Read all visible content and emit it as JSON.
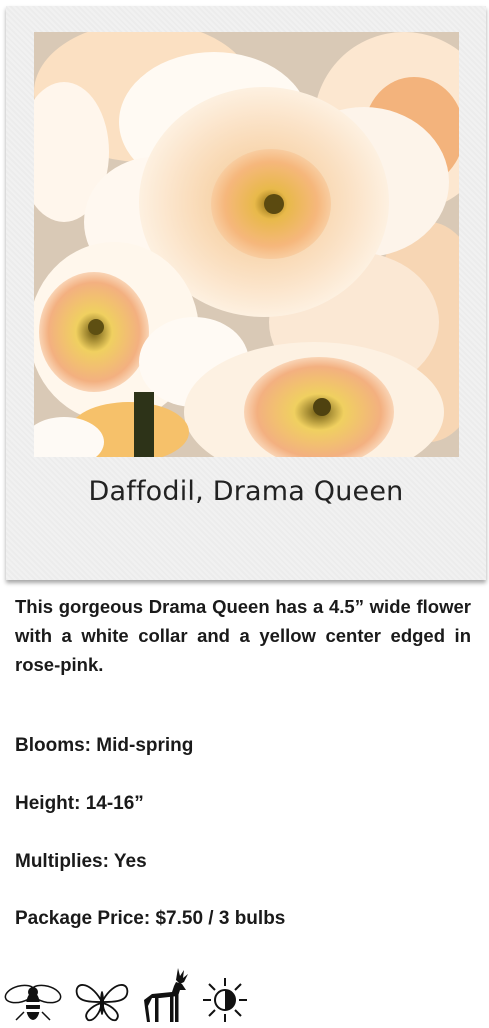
{
  "card": {
    "title": "Daffodil, Drama Queen",
    "photo_icon": "daffodil-flower-photo"
  },
  "description": "This gorgeous Drama Queen has a 4.5” wide flower with a white collar and a yellow center edged in rose-pink.",
  "specs": {
    "blooms": "Blooms: Mid-spring",
    "height": "Height: 14-16”",
    "multiplies": "Multiplies: Yes",
    "price": "Package Price: $7.50 / 3 bulbs"
  },
  "icons": [
    "bee-icon",
    "butterfly-icon",
    "deer-icon",
    "sun-icon"
  ]
}
